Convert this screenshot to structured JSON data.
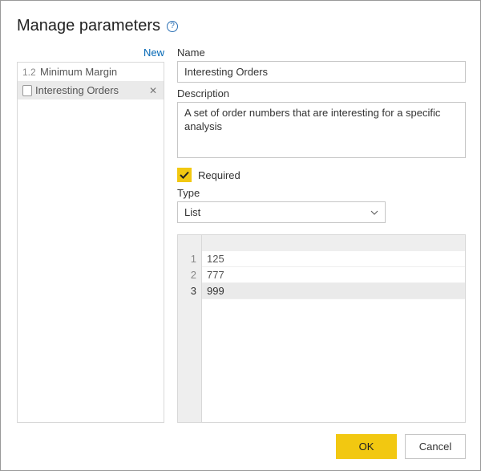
{
  "title": "Manage parameters",
  "new_link": "New",
  "sidebar": {
    "items": [
      {
        "prefix": "1.2",
        "label": "Minimum Margin",
        "selected": false
      },
      {
        "prefix": "",
        "label": "Interesting Orders",
        "selected": true
      }
    ]
  },
  "form": {
    "name_label": "Name",
    "name_value": "Interesting Orders",
    "description_label": "Description",
    "description_value": "A set of order numbers that are interesting for a specific analysis",
    "required_label": "Required",
    "required_checked": true,
    "type_label": "Type",
    "type_value": "List"
  },
  "list_values": {
    "rows": [
      {
        "n": "1",
        "v": "125"
      },
      {
        "n": "2",
        "v": "777"
      },
      {
        "n": "3",
        "v": "999"
      }
    ]
  },
  "buttons": {
    "ok": "OK",
    "cancel": "Cancel"
  }
}
